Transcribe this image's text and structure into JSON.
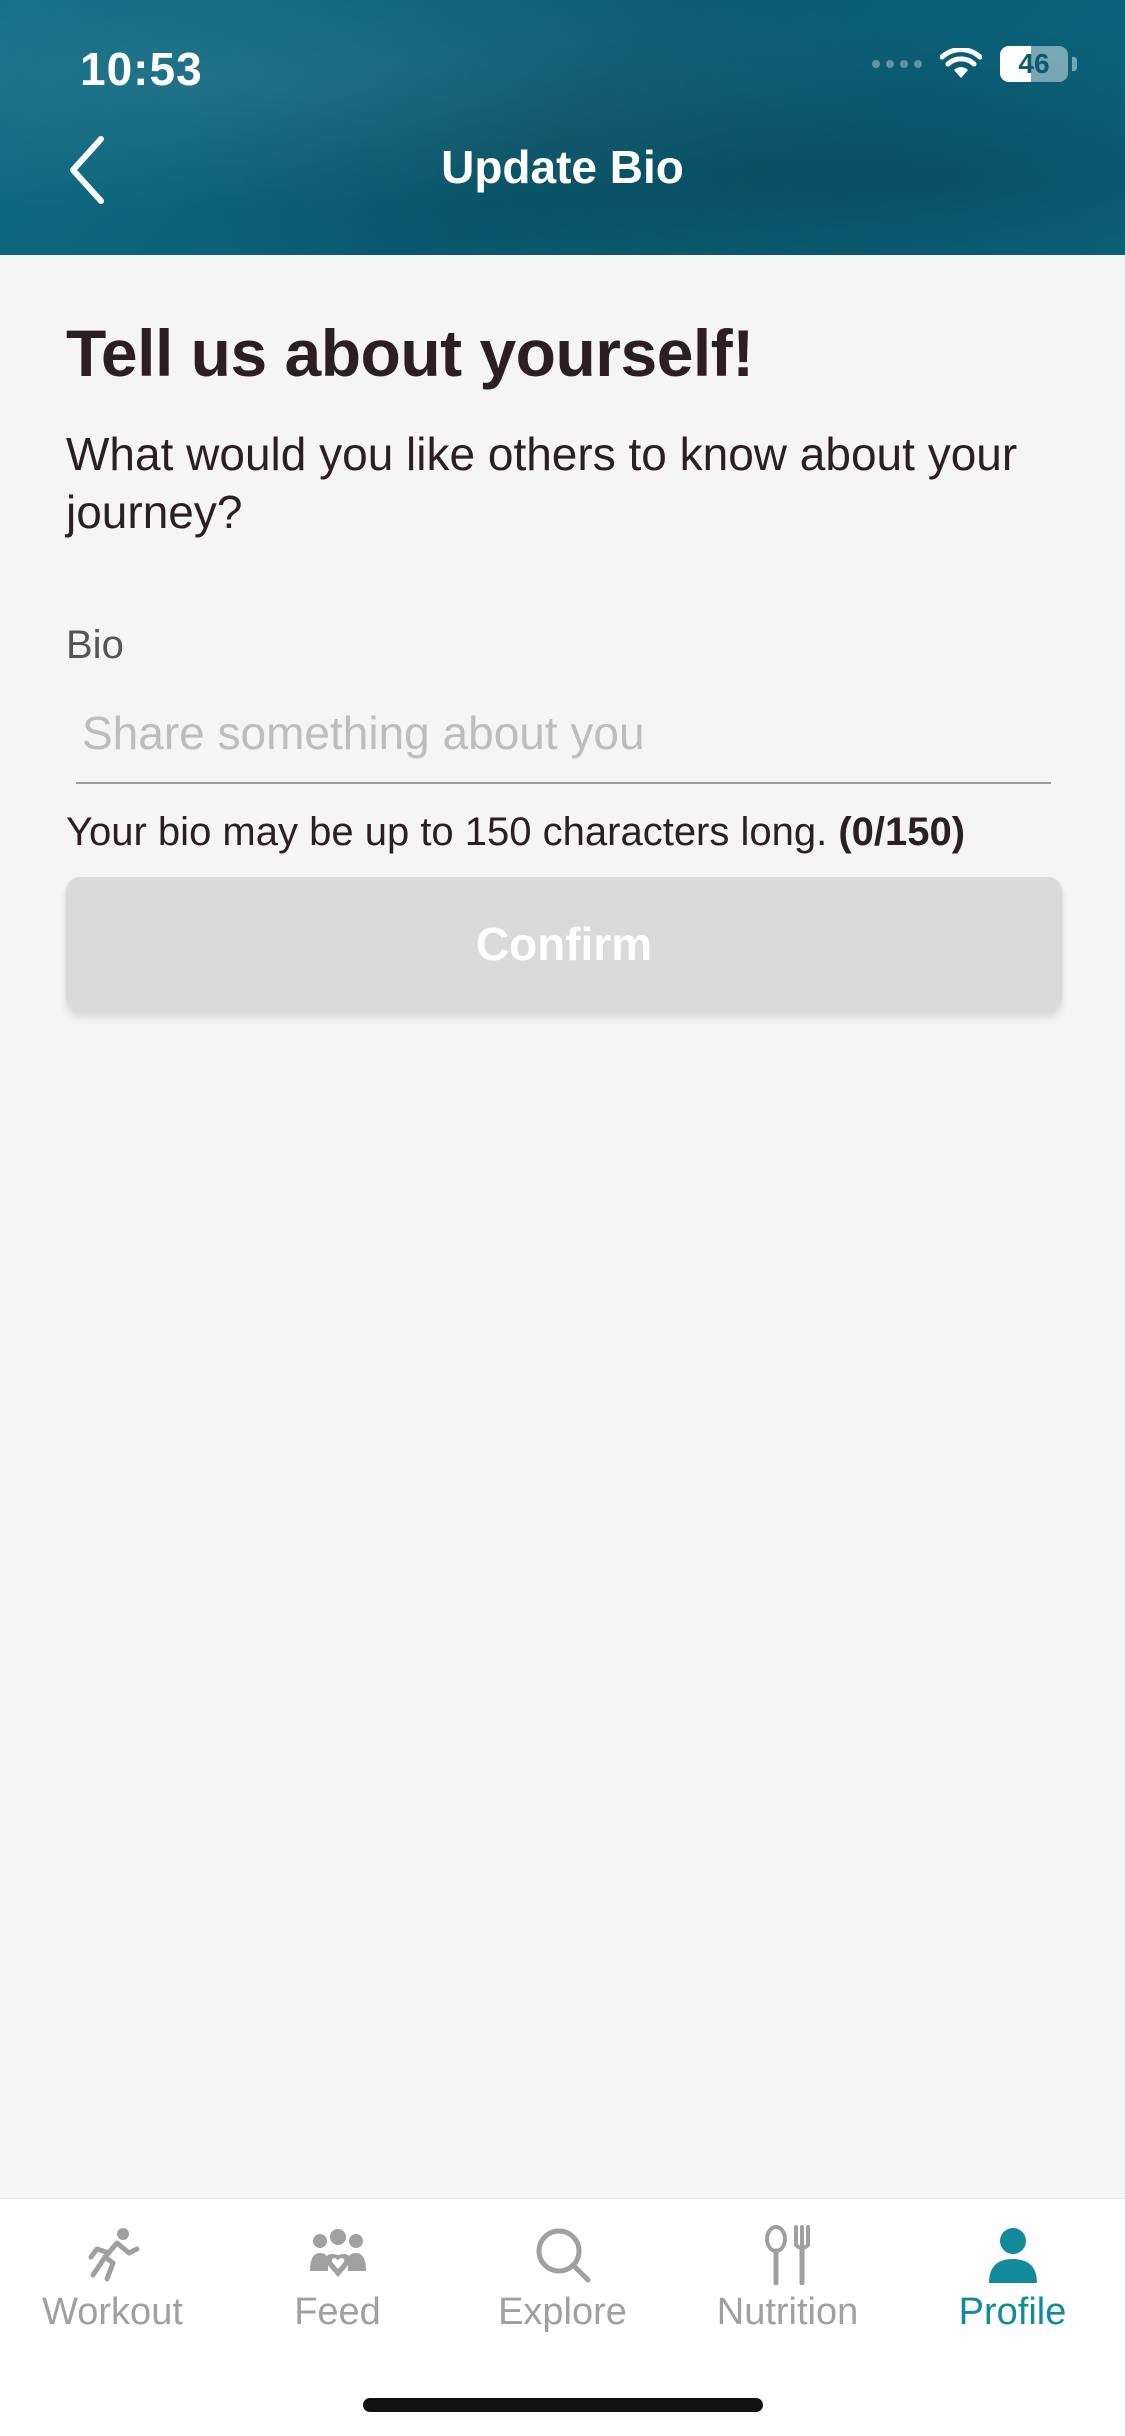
{
  "status_bar": {
    "time": "10:53",
    "battery": "46"
  },
  "header": {
    "title": "Update Bio"
  },
  "form": {
    "headline": "Tell us about yourself!",
    "subhead": "What would you like others to know about your journey?",
    "bio_label": "Bio",
    "bio_placeholder": "Share something about you",
    "bio_value": "",
    "hint_text": "Your bio may be up to 150 characters long.",
    "char_count": "(0/150)",
    "confirm_label": "Confirm"
  },
  "tabbar": {
    "items": [
      {
        "label": "Workout",
        "icon": "running-person-icon",
        "active": false
      },
      {
        "label": "Feed",
        "icon": "people-heart-icon",
        "active": false
      },
      {
        "label": "Explore",
        "icon": "search-icon",
        "active": false
      },
      {
        "label": "Nutrition",
        "icon": "fork-spoon-icon",
        "active": false
      },
      {
        "label": "Profile",
        "icon": "person-icon",
        "active": true
      }
    ]
  },
  "colors": {
    "header_bg": "#0a5a70",
    "accent": "#138a9b",
    "text_dark": "#2c1f24",
    "button_disabled": "#dadada",
    "tab_inactive": "#a0a0a0"
  }
}
